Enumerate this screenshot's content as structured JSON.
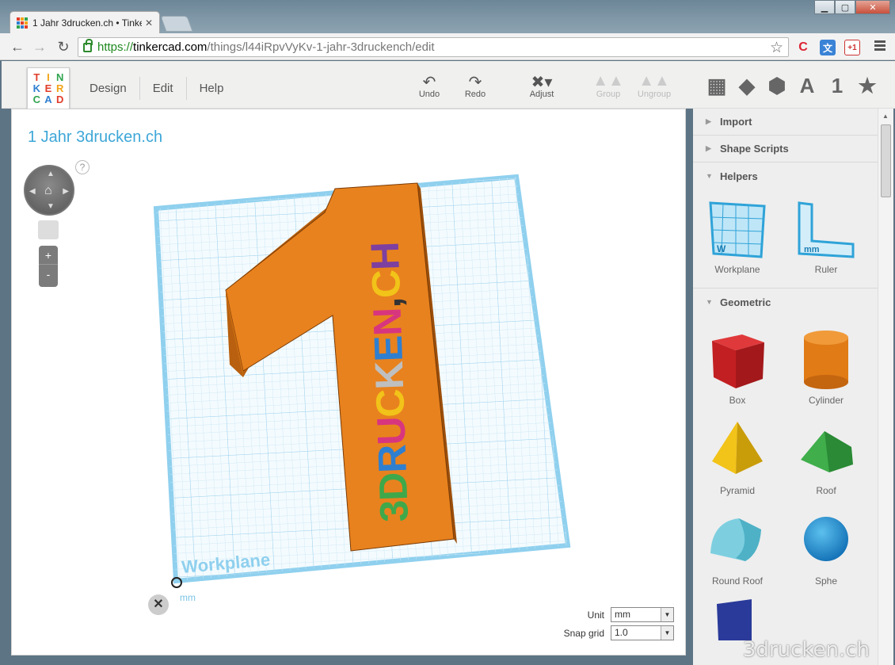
{
  "browser": {
    "tab_title": "1 Jahr 3drucken.ch • Tinke",
    "url_scheme": "https://",
    "url_host": "tinkercad.com",
    "url_path": "/things/l44iRpvVyKv-1-jahr-3druckench/edit",
    "ext_gplus": "+1"
  },
  "app": {
    "logo_letters": [
      "T",
      "I",
      "N",
      "K",
      "E",
      "R",
      "C",
      "A",
      "D"
    ],
    "menu": [
      "Design",
      "Edit",
      "Help"
    ],
    "tools": {
      "undo": "Undo",
      "redo": "Redo",
      "adjust": "Adjust",
      "group": "Group",
      "ungroup": "Ungroup"
    },
    "view_text_a": "A",
    "view_text_1": "1"
  },
  "canvas": {
    "design_title": "1 Jahr 3drucken.ch",
    "help": "?",
    "zoom_in": "+",
    "zoom_out": "-",
    "workplane_label": "Workplane",
    "axis_unit": "mm",
    "model_text": "3DRUCKEN.CH",
    "unit_label": "Unit",
    "unit_value": "mm",
    "snap_label": "Snap grid",
    "snap_value": "1.0"
  },
  "panel": {
    "sections": {
      "import": "Import",
      "scripts": "Shape Scripts",
      "helpers": "Helpers",
      "geometric": "Geometric"
    },
    "helpers": [
      "Workplane",
      "Ruler"
    ],
    "helper_letters": {
      "workplane": "W",
      "ruler": "mm"
    },
    "geometric": [
      "Box",
      "Cylinder",
      "Pyramid",
      "Roof",
      "Round Roof",
      "Sphe"
    ],
    "watermark": "3drucken.ch"
  },
  "colors": {
    "accent": "#3ea7d8",
    "model_orange": "#e8821e",
    "grid": "#bfe6f7"
  }
}
